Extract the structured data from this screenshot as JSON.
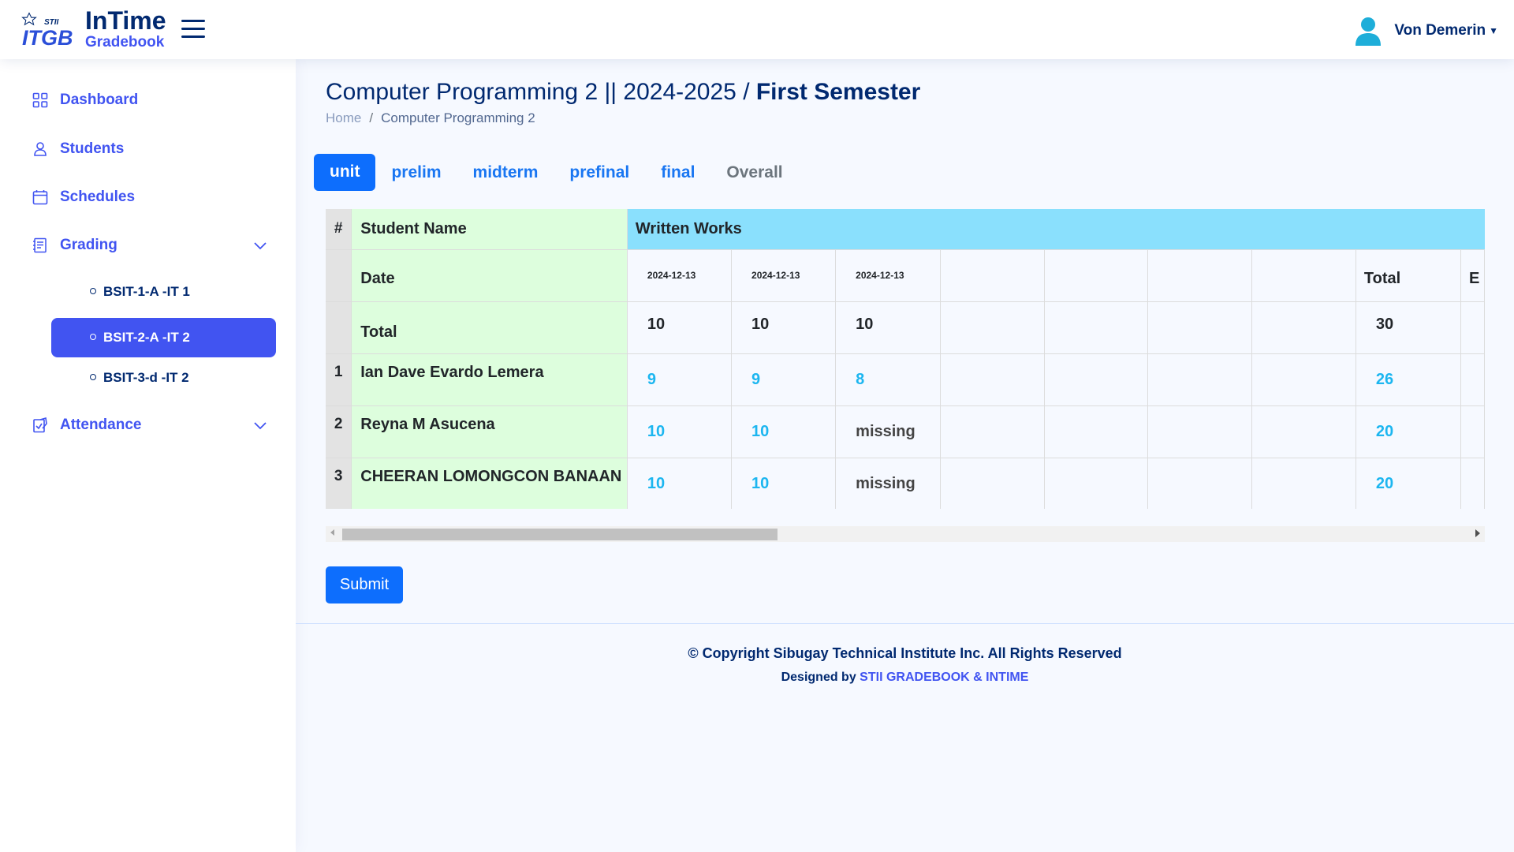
{
  "header": {
    "brand_title": "InTime",
    "brand_sub": "Gradebook",
    "logo_text": "ITGB",
    "user_name": "Von Demerin"
  },
  "sidebar": {
    "items": [
      {
        "label": "Dashboard",
        "icon": "grid-icon"
      },
      {
        "label": "Students",
        "icon": "person-icon"
      },
      {
        "label": "Schedules",
        "icon": "calendar-icon"
      },
      {
        "label": "Grading",
        "icon": "journal-icon"
      },
      {
        "label": "Attendance",
        "icon": "journal-check-icon"
      }
    ],
    "grading_sub": [
      {
        "label": "BSIT-1-A -IT 1",
        "active": false
      },
      {
        "label": "BSIT-2-A -IT 2",
        "active": true
      },
      {
        "label": "BSIT-3-d -IT 2",
        "active": false
      }
    ]
  },
  "page": {
    "title_main": "Computer Programming 2 || 2024-2025 / ",
    "title_bold": "First Semester",
    "breadcrumb_home": "Home",
    "breadcrumb_sep": "/",
    "breadcrumb_current": "Computer Programming 2"
  },
  "tabs": [
    "unit",
    "prelim",
    "midterm",
    "prefinal",
    "final",
    "Overall"
  ],
  "table": {
    "hash": "#",
    "student_name_header": "Student Name",
    "written_works_header": "Written Works",
    "date_label": "Date",
    "total_label": "Total",
    "dates": [
      "2024-12-13",
      "2024-12-13",
      "2024-12-13",
      "",
      "",
      "",
      ""
    ],
    "date_total_header": "Total",
    "extra_header": "E",
    "max_scores": [
      "10",
      "10",
      "10",
      "",
      "",
      "",
      ""
    ],
    "max_total": "30",
    "students": [
      {
        "num": "1",
        "name": "Ian Dave Evardo Lemera",
        "scores": [
          "9",
          "9",
          "8",
          "",
          "",
          "",
          ""
        ],
        "total": "26"
      },
      {
        "num": "2",
        "name": "Reyna M Asucena",
        "scores": [
          "10",
          "10",
          "missing",
          "",
          "",
          "",
          ""
        ],
        "total": "20"
      },
      {
        "num": "3",
        "name": "CHEERAN LOMONGCON BANAAN",
        "scores": [
          "10",
          "10",
          "missing",
          "",
          "",
          "",
          ""
        ],
        "total": "20"
      }
    ]
  },
  "submit_label": "Submit",
  "footer": {
    "copyright": "© Copyright Sibugay Technical Institute Inc. All Rights Reserved",
    "designed_prefix": "Designed by ",
    "designed_link": "STII GRADEBOOK & INTIME"
  },
  "colors": {
    "brand": "#012970",
    "accent": "#4154f1",
    "primary": "#0d6efd",
    "score_blue": "#1cb6f0",
    "name_bg": "#ddfedd",
    "written_works_bg": "#8ae0fd"
  }
}
